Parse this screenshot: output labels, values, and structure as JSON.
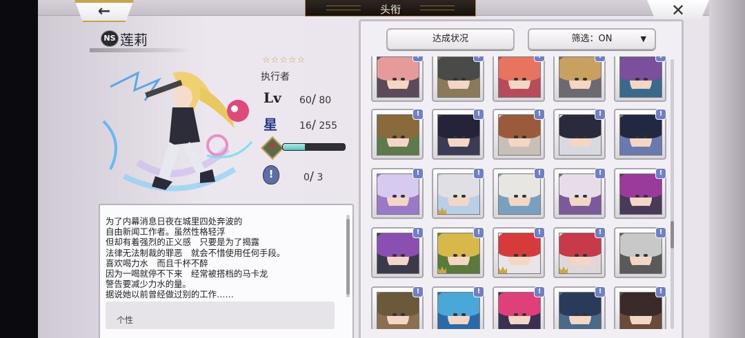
{
  "header": {
    "title": "头衔",
    "back_icon": "←",
    "close_icon": "✕"
  },
  "character": {
    "badge": "NS",
    "name": "莲莉",
    "stars": "☆☆☆☆☆",
    "class": "执行者",
    "lv_label": "Lv",
    "lv_current": "60",
    "lv_max": "80",
    "rank_label": "星",
    "rank_current": "16",
    "rank_max": "255",
    "exp_fraction": 0.35,
    "awaken_icon": "!",
    "awaken_current": "0",
    "awaken_max": "3"
  },
  "description": {
    "lines": [
      "为了内幕消息日夜在城里四处奔波的",
      "自由新闻工作者。虽然性格轻浮",
      "但却有着强烈的正义感　只要是为了揭露",
      "法律无法制裁的罪恶　就会不惜使用任何手段。",
      "喜欢喝力水　而且千杯不醉",
      "因为一喝就停不下来　经常被搭档的马卡龙",
      "警告要减少力水的量。",
      "据说她以前曾经做过别的工作……"
    ],
    "personality_tab": "个性"
  },
  "panel": {
    "status_button": "达成状况",
    "filter_button": "筛选：ON",
    "filter_caret": "▼",
    "exclaim": "!"
  },
  "colors": {
    "accent_gold": "#c9a84a",
    "badge_blue": "#6f80c8",
    "exp_teal": "#6fd0cb"
  },
  "portraits": [
    {
      "hair": "#e79a9a",
      "cloth": "#5a4a5a",
      "crown": false
    },
    {
      "hair": "#4a4a48",
      "cloth": "#8a7a5a",
      "crown": false
    },
    {
      "hair": "#e8735e",
      "cloth": "#b84b5a",
      "crown": false
    },
    {
      "hair": "#c8a060",
      "cloth": "#6a6a70",
      "crown": false
    },
    {
      "hair": "#7a4f9c",
      "cloth": "#3a6a8a",
      "crown": false
    },
    {
      "hair": "#8a6a3a",
      "cloth": "#5f7a4a",
      "crown": false
    },
    {
      "hair": "#25233a",
      "cloth": "#3b3b55",
      "crown": false
    },
    {
      "hair": "#9a5b3a",
      "cloth": "#c8c0b8",
      "crown": false
    },
    {
      "hair": "#2a2a3e",
      "cloth": "#d8d8e0",
      "crown": false
    },
    {
      "hair": "#222840",
      "cloth": "#6a7ab0",
      "crown": false
    },
    {
      "hair": "#d7c9ef",
      "cloth": "#9a7ac8",
      "crown": false
    },
    {
      "hair": "#e0e0e4",
      "cloth": "#b7d0e8",
      "crown": true
    },
    {
      "hair": "#e8e6e2",
      "cloth": "#7aa0c0",
      "crown": false
    },
    {
      "hair": "#e6dde8",
      "cloth": "#7a5a9a",
      "crown": false
    },
    {
      "hair": "#9a3a9a",
      "cloth": "#4a3a5a",
      "crown": false
    },
    {
      "hair": "#8a4fb0",
      "cloth": "#3a3a4a",
      "crown": false
    },
    {
      "hair": "#d9b84a",
      "cloth": "#5a7a3a",
      "crown": true
    },
    {
      "hair": "#d63a3a",
      "cloth": "#e8e4e8",
      "crown": true
    },
    {
      "hair": "#c83a4a",
      "cloth": "#e0d8d8",
      "crown": true
    },
    {
      "hair": "#c8c8c8",
      "cloth": "#5a5a5a",
      "crown": false
    },
    {
      "hair": "#6a5a3a",
      "cloth": "#8a7050",
      "crown": false
    },
    {
      "hair": "#4aa8d8",
      "cloth": "#2a6aa8",
      "crown": false
    },
    {
      "hair": "#e0407a",
      "cloth": "#3a3050",
      "crown": false
    },
    {
      "hair": "#2a3a5a",
      "cloth": "#4a6a8a",
      "crown": false
    },
    {
      "hair": "#3a2a2a",
      "cloth": "#6a4a3a",
      "crown": false
    }
  ]
}
